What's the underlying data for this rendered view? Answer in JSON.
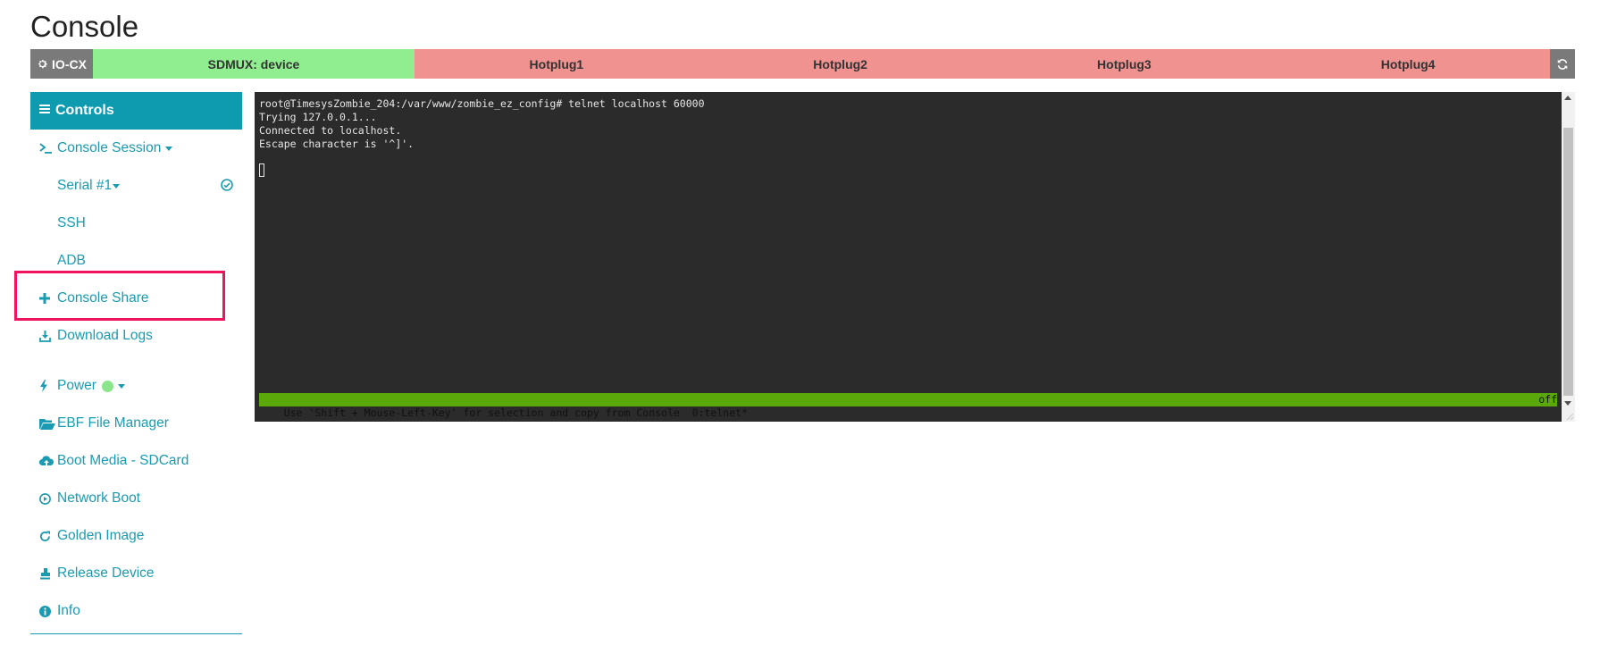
{
  "page": {
    "title": "Console"
  },
  "statusbar": {
    "device_label": "IO-CX",
    "sdmux_label": "SDMUX: device",
    "hotplugs": [
      "Hotplug1",
      "Hotplug2",
      "Hotplug3",
      "Hotplug4"
    ],
    "colors": {
      "device": "#7a7a7a",
      "sdmux": "#90ee90",
      "hotplug": "#f09290"
    }
  },
  "sidebar": {
    "header": "Controls",
    "console_session": "Console Session",
    "serial": "Serial #1",
    "ssh": "SSH",
    "adb": "ADB",
    "console_share": "Console Share",
    "download_logs": "Download Logs",
    "power": "Power",
    "ebf_file_manager": "EBF File Manager",
    "boot_media": "Boot Media - SDCard",
    "network_boot": "Network Boot",
    "golden_image": "Golden Image",
    "release_device": "Release Device",
    "info": "Info",
    "accent_color": "#0e9bb0",
    "power_status_color": "#8be68b"
  },
  "terminal": {
    "lines": [
      "root@TimesysZombie_204:/var/www/zombie_ez_config# telnet localhost 60000",
      "Trying 127.0.0.1...",
      "Connected to localhost.",
      "Escape character is '^]'."
    ],
    "status_left": "Use 'Shift + Mouse-Left-Key' for selection and copy from Console  0:telnet*",
    "status_right": "off",
    "background": "#2b2b2b",
    "status_color": "#5aa80a"
  }
}
